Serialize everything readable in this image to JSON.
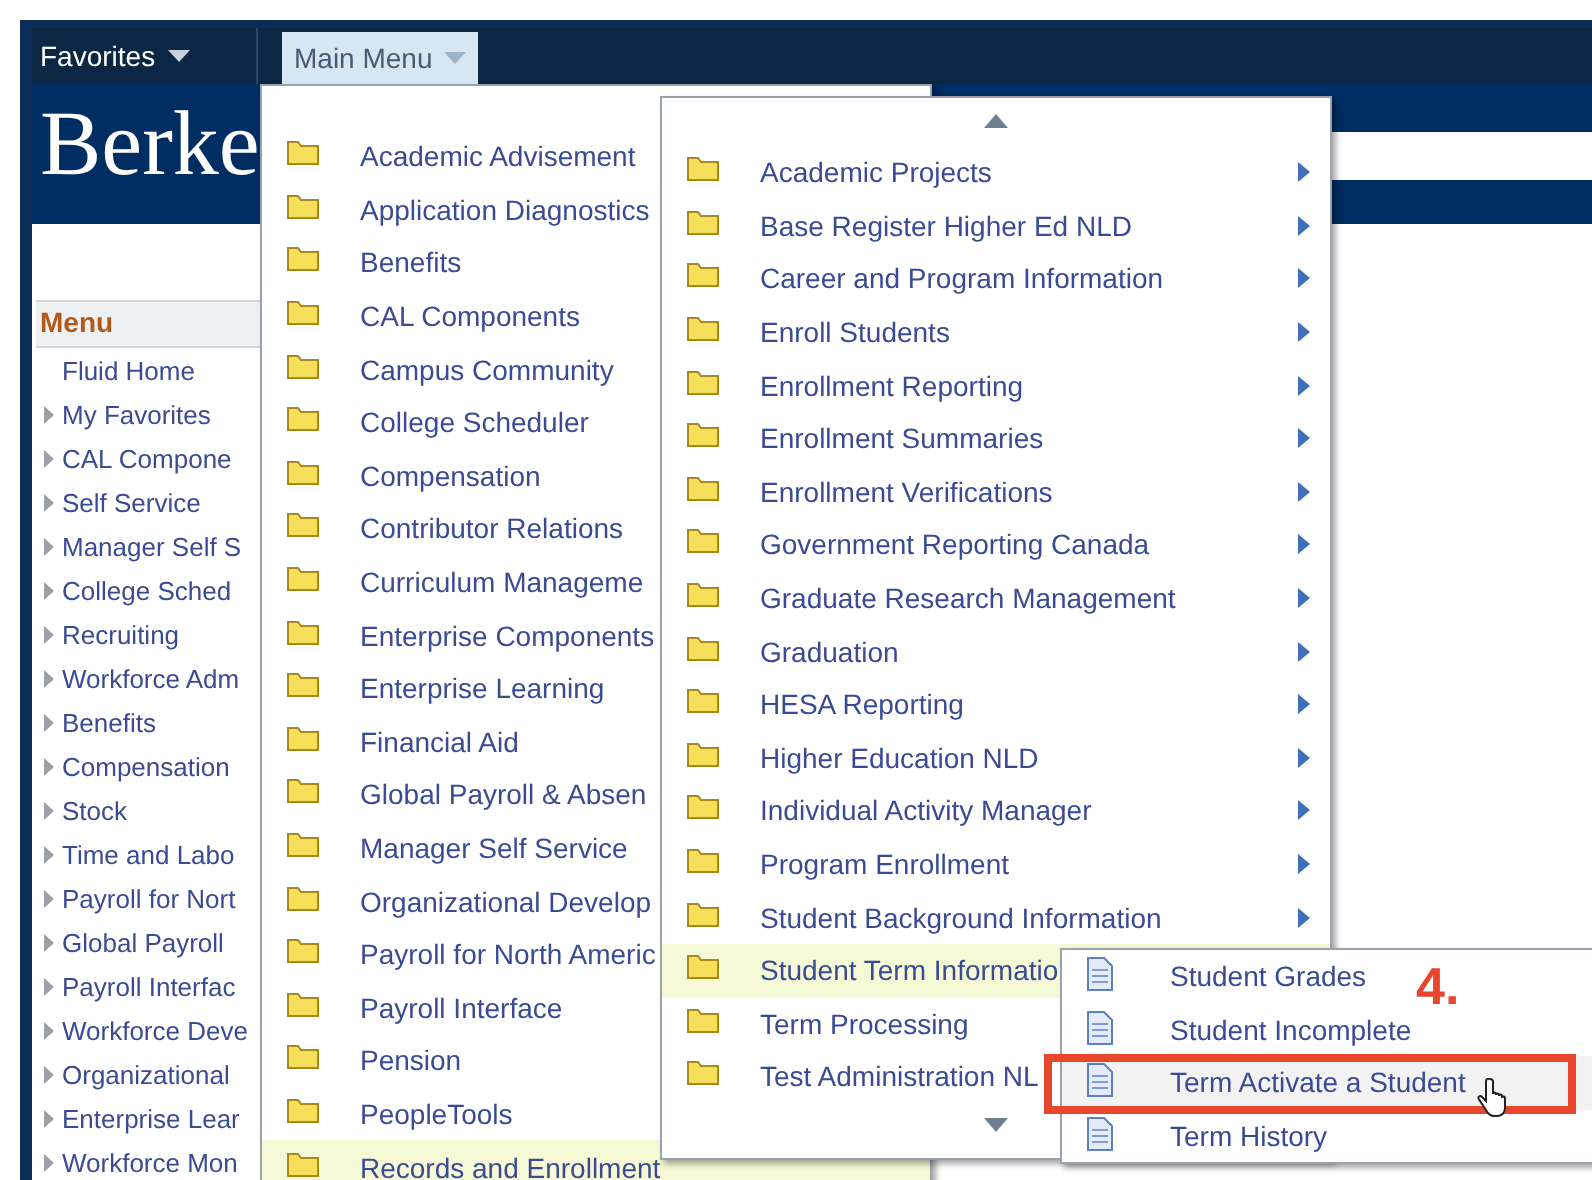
{
  "top_bar": {
    "favorites": "Favorites",
    "main_menu": {
      "label": "Main Menu",
      "selected": true
    }
  },
  "banner": {
    "logo": "Berke"
  },
  "sidebar": {
    "title": "Menu",
    "items": [
      {
        "label": "Fluid Home",
        "expandable": false
      },
      {
        "label": "My Favorites",
        "expandable": true
      },
      {
        "label": "CAL Compone",
        "expandable": true
      },
      {
        "label": "Self Service",
        "expandable": true
      },
      {
        "label": "Manager Self S",
        "expandable": true
      },
      {
        "label": "College Sched",
        "expandable": true
      },
      {
        "label": "Recruiting",
        "expandable": true
      },
      {
        "label": "Workforce Adm",
        "expandable": true
      },
      {
        "label": "Benefits",
        "expandable": true
      },
      {
        "label": "Compensation",
        "expandable": true
      },
      {
        "label": "Stock",
        "expandable": true
      },
      {
        "label": "Time and Labo",
        "expandable": true
      },
      {
        "label": "Payroll for Nort",
        "expandable": true
      },
      {
        "label": "Global Payroll",
        "expandable": true
      },
      {
        "label": "Payroll Interfac",
        "expandable": true
      },
      {
        "label": "Workforce Deve",
        "expandable": true
      },
      {
        "label": "Organizational",
        "expandable": true
      },
      {
        "label": "Enterprise Lear",
        "expandable": true
      },
      {
        "label": "Workforce Mon",
        "expandable": true
      }
    ]
  },
  "main_menu": {
    "items": [
      {
        "label": "Academic Advisement",
        "selected": false
      },
      {
        "label": "Application Diagnostics",
        "selected": false
      },
      {
        "label": "Benefits",
        "selected": false
      },
      {
        "label": "CAL Components",
        "selected": false
      },
      {
        "label": "Campus Community",
        "selected": false
      },
      {
        "label": "College Scheduler",
        "selected": false
      },
      {
        "label": "Compensation",
        "selected": false
      },
      {
        "label": "Contributor Relations",
        "selected": false
      },
      {
        "label": "Curriculum Manageme",
        "selected": false
      },
      {
        "label": "Enterprise Components",
        "selected": false
      },
      {
        "label": "Enterprise Learning",
        "selected": false
      },
      {
        "label": "Financial Aid",
        "selected": false
      },
      {
        "label": "Global Payroll & Absen",
        "selected": false
      },
      {
        "label": "Manager Self Service",
        "selected": false
      },
      {
        "label": "Organizational Develop",
        "selected": false
      },
      {
        "label": "Payroll for North Americ",
        "selected": false
      },
      {
        "label": "Payroll Interface",
        "selected": false
      },
      {
        "label": "Pension",
        "selected": false
      },
      {
        "label": "PeopleTools",
        "selected": false
      },
      {
        "label": "Records and Enrollment",
        "selected": true
      }
    ]
  },
  "submenu": {
    "items": [
      {
        "label": "Academic Projects",
        "arrow": true,
        "selected": false
      },
      {
        "label": "Base Register Higher Ed NLD",
        "arrow": true,
        "selected": false
      },
      {
        "label": "Career and Program Information",
        "arrow": true,
        "selected": false
      },
      {
        "label": "Enroll Students",
        "arrow": true,
        "selected": false
      },
      {
        "label": "Enrollment Reporting",
        "arrow": true,
        "selected": false
      },
      {
        "label": "Enrollment Summaries",
        "arrow": true,
        "selected": false
      },
      {
        "label": "Enrollment Verifications",
        "arrow": true,
        "selected": false
      },
      {
        "label": "Government Reporting Canada",
        "arrow": true,
        "selected": false
      },
      {
        "label": "Graduate Research Management",
        "arrow": true,
        "selected": false
      },
      {
        "label": "Graduation",
        "arrow": true,
        "selected": false
      },
      {
        "label": "HESA Reporting",
        "arrow": true,
        "selected": false
      },
      {
        "label": "Higher Education NLD",
        "arrow": true,
        "selected": false
      },
      {
        "label": "Individual Activity Manager",
        "arrow": true,
        "selected": false
      },
      {
        "label": "Program Enrollment",
        "arrow": true,
        "selected": false
      },
      {
        "label": "Student Background Information",
        "arrow": true,
        "selected": false
      },
      {
        "label": "Student Term Informatio",
        "arrow": false,
        "selected": true
      },
      {
        "label": "Term Processing",
        "arrow": false,
        "selected": false
      },
      {
        "label": "Test Administration NL",
        "arrow": false,
        "selected": false
      }
    ]
  },
  "pages_menu": {
    "items": [
      {
        "label": "Student Grades",
        "hovered": false,
        "highlighted": false
      },
      {
        "label": "Student Incomplete",
        "hovered": false,
        "highlighted": false
      },
      {
        "label": "Term Activate a Student",
        "hovered": true,
        "highlighted": true
      },
      {
        "label": "Term History",
        "hovered": false,
        "highlighted": false
      }
    ]
  },
  "annotation": {
    "label": "4."
  }
}
